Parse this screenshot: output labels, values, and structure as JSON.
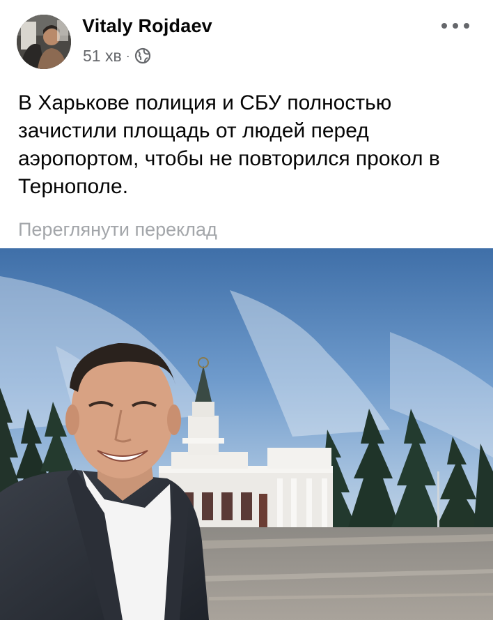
{
  "post": {
    "author": "Vitaly Rojdaev",
    "time": "51 хв",
    "separator": "·",
    "privacy_icon": "globe-icon",
    "more_icon": "more-options-icon",
    "text": "В Харькове полиция и СБУ полностью\nзачистили площадь от людей перед\nаэропортом, чтобы не повторился прокол в\nТернополе.",
    "see_translation": "Переглянути переклад"
  },
  "colors": {
    "author": "#050505",
    "meta": "#65676b",
    "translation_link": "#a3a6aa",
    "background": "#ffffff"
  }
}
